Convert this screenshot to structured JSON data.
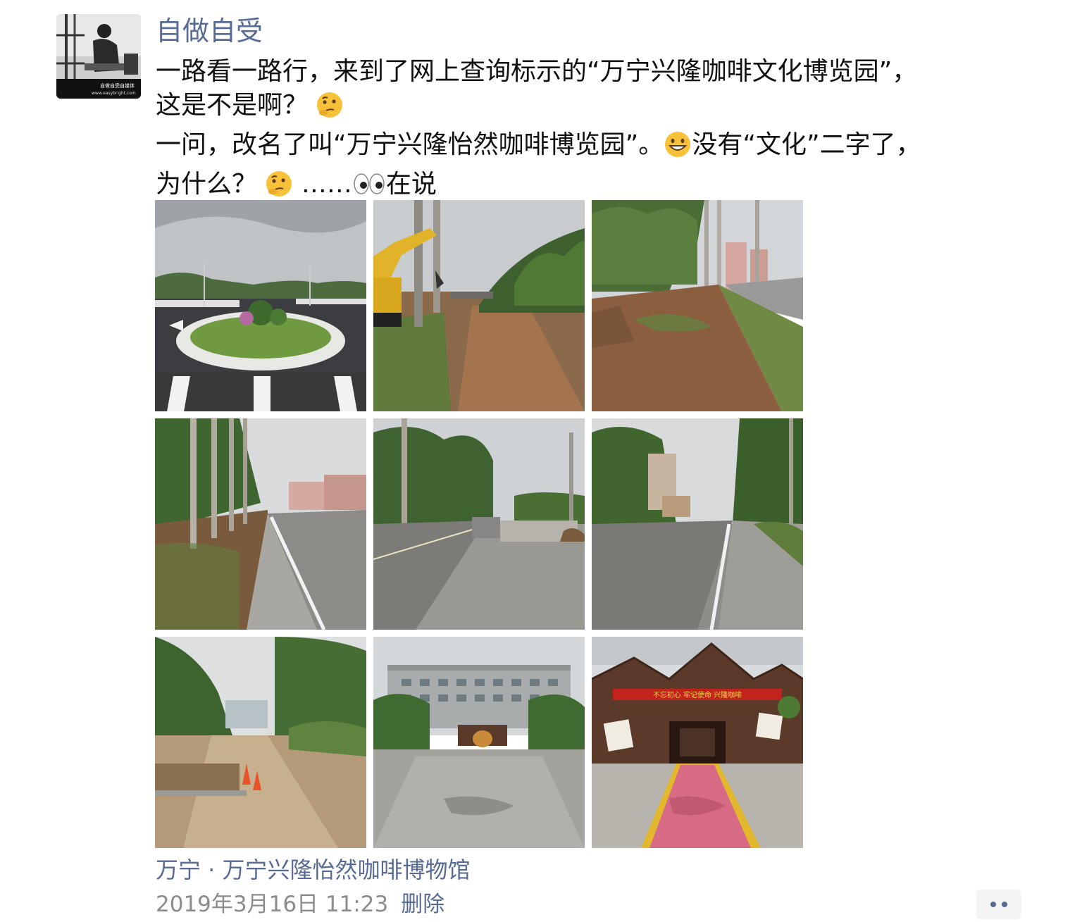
{
  "post": {
    "author": "自做自受",
    "avatar_icon": "avatar-photo-icon",
    "avatar_caption": "自做自受自媒体",
    "avatar_url_text": "www.easybright.com",
    "text_line1": "一路看一路行，来到了网上查询标示的“万宁兴隆咖啡文化博览园”，",
    "text_line2": "这是不是啊？",
    "text_line3a": "一问，改名了叫“万宁兴隆怡然咖啡博览园”。",
    "text_line3b": "没有“文化”二字了，",
    "text_line4a": "为什么？",
    "text_line4b": "……",
    "text_line4c": "在说",
    "emojis": [
      "thinking-face-emoji",
      "grinning-face-emoji",
      "eyes-emoji"
    ],
    "photos": [
      {
        "icon": "roundabout-road-photo"
      },
      {
        "icon": "excavator-roadside-photo"
      },
      {
        "icon": "cleared-palm-roadside-photo"
      },
      {
        "icon": "palm-tree-avenue-photo"
      },
      {
        "icon": "road-construction-photo"
      },
      {
        "icon": "empty-road-photo"
      },
      {
        "icon": "dirt-lane-traffic-cones-photo"
      },
      {
        "icon": "building-courtyard-photo"
      },
      {
        "icon": "coffee-museum-entrance-photo"
      }
    ],
    "banner_text": "不忘初心 牢记使命 兴隆咖啡",
    "location": "万宁 · 万宁兴隆怡然咖啡博物馆",
    "timestamp": "2019年3月16日 11:23",
    "delete_label": "删除",
    "more_icon": "more-options-icon"
  },
  "colors": {
    "link": "#576b95",
    "text": "#111111",
    "meta": "#8c8c8c",
    "more_bg": "#f4f4f4"
  }
}
